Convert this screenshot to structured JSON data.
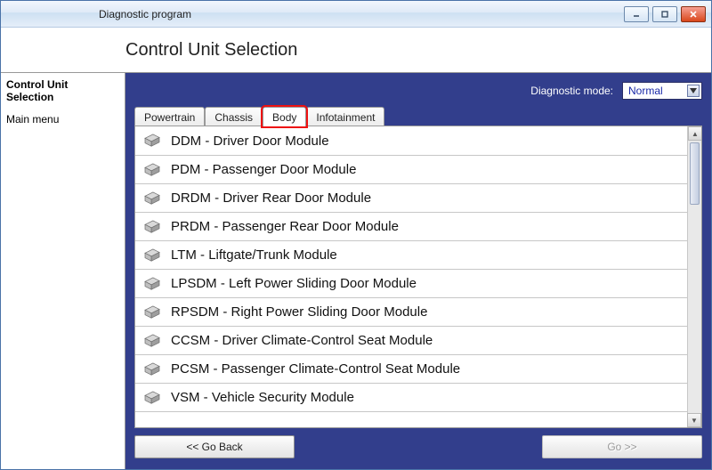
{
  "window": {
    "title": "Diagnostic program"
  },
  "header": {
    "title": "Control Unit Selection"
  },
  "sidebar": {
    "selected_line1": "Control Unit",
    "selected_line2": "Selection",
    "items": [
      {
        "label": "Main menu"
      }
    ]
  },
  "mode": {
    "label": "Diagnostic mode:",
    "value": "Normal"
  },
  "tabs": [
    {
      "label": "Powertrain",
      "active": false
    },
    {
      "label": "Chassis",
      "active": false
    },
    {
      "label": "Body",
      "active": true,
      "highlight": true
    },
    {
      "label": "Infotainment",
      "active": false
    }
  ],
  "modules": [
    {
      "label": "DDM - Driver Door Module"
    },
    {
      "label": "PDM - Passenger Door Module"
    },
    {
      "label": "DRDM - Driver Rear Door Module"
    },
    {
      "label": "PRDM - Passenger Rear Door Module"
    },
    {
      "label": "LTM - Liftgate/Trunk Module"
    },
    {
      "label": "LPSDM - Left Power Sliding Door Module"
    },
    {
      "label": "RPSDM - Right Power Sliding Door Module"
    },
    {
      "label": "CCSM - Driver Climate-Control Seat Module"
    },
    {
      "label": "PCSM - Passenger Climate-Control Seat Module"
    },
    {
      "label": "VSM - Vehicle Security Module"
    }
  ],
  "buttons": {
    "back": "<< Go Back",
    "go": "Go >>"
  }
}
